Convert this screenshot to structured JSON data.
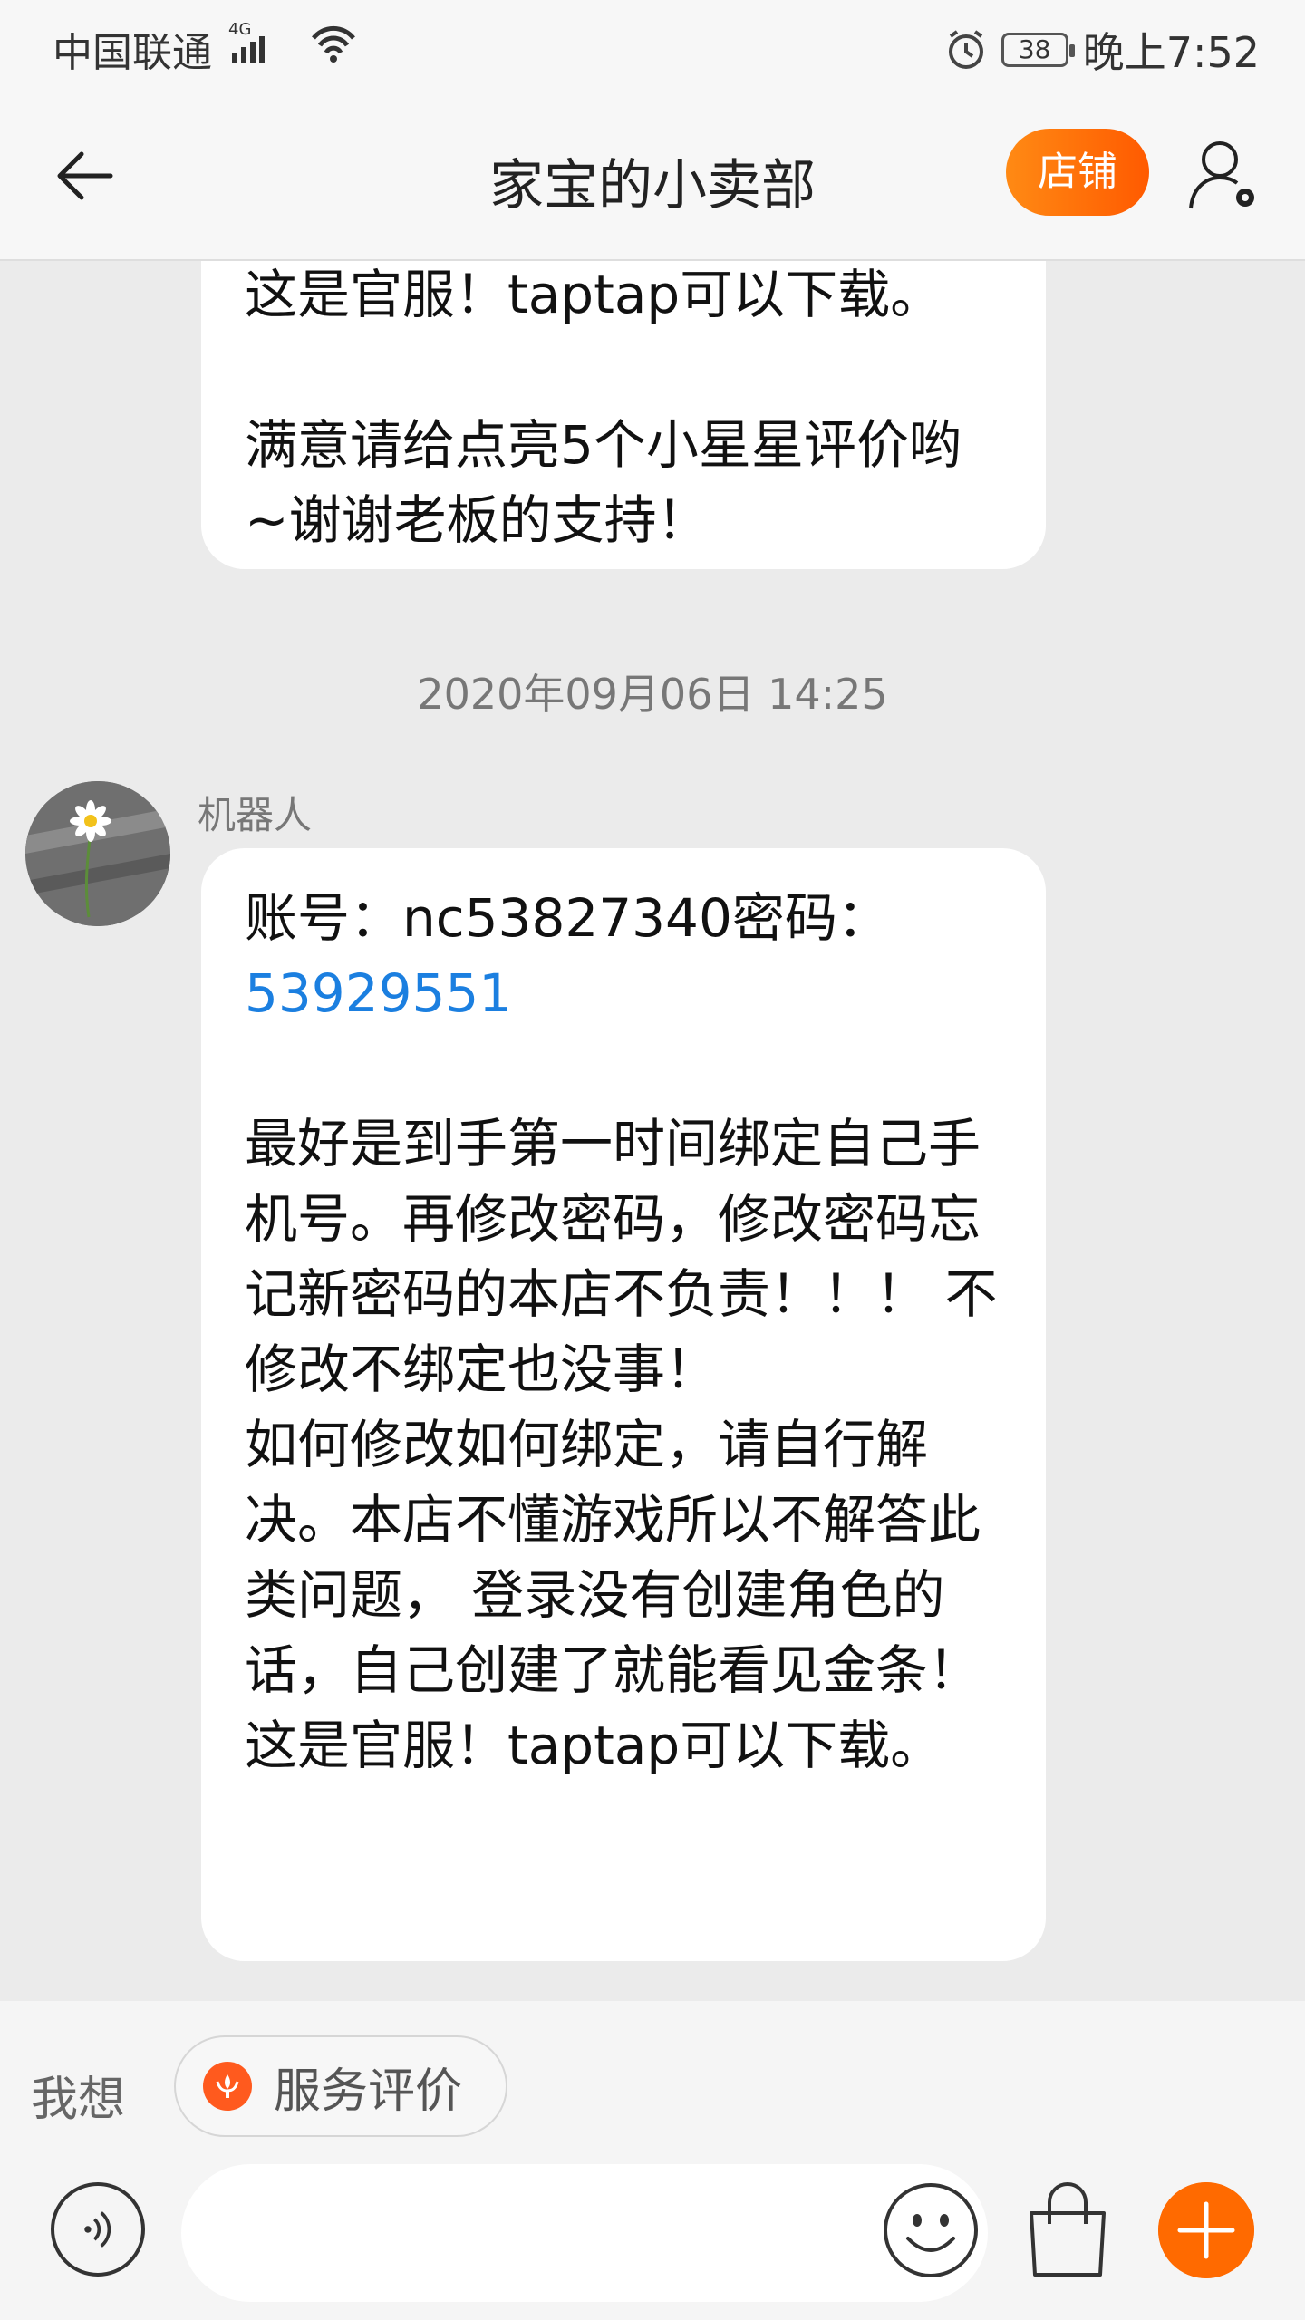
{
  "status_bar": {
    "carrier": "中国联通",
    "network": "4G",
    "battery": "38",
    "time": "晚上7:52"
  },
  "header": {
    "title": "家宝的小卖部",
    "shop_button": "店铺"
  },
  "messages": {
    "prev_bubble_text": "这是官服！taptap可以下载。\n\n满意请给点亮5个小星星评价哟~谢谢老板的支持！",
    "timestamp": "2020年09月06日 14:25",
    "sender_name": "机器人",
    "account_line": "账号：nc53827340密码：",
    "password_value": "53929551",
    "body_text": "最好是到手第一时间绑定自己手机号。再修改密码，修改密码忘记新密码的本店不负责！！！ 不修改不绑定也没事！\n如何修改如何绑定，请自行解决。本店不懂游戏所以不解答此类问题， 登录没有创建角色的话，自己创建了就能看见金条！ 这是官服！taptap可以下载。"
  },
  "quick_bar": {
    "label": "我想",
    "chip_label": "服务评价"
  },
  "colors": {
    "accent_orange": "#ff6a00",
    "link_blue": "#1b7fe0",
    "chip_icon": "#ff5a1e"
  },
  "icons": [
    "back-arrow-icon",
    "user-settings-icon",
    "voice-icon",
    "emoji-icon",
    "shopping-bag-icon",
    "plus-icon",
    "service-rating-icon",
    "wifi-icon",
    "signal-icon",
    "alarm-icon",
    "battery-icon"
  ]
}
